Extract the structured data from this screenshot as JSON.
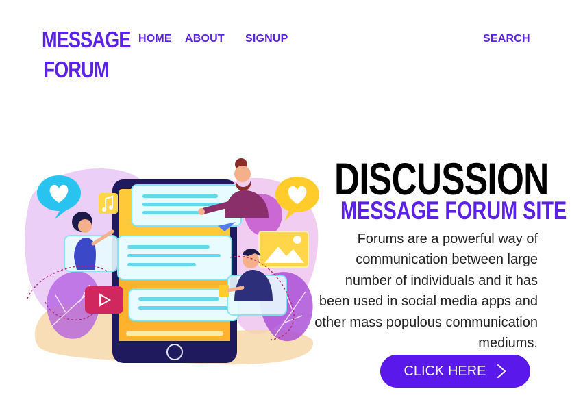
{
  "logo": {
    "line1": "MESSAGE",
    "line2": "FORUM"
  },
  "nav": {
    "home": "HOME",
    "about": "ABOUT",
    "signup": "SIGNUP",
    "search": "SEARCH"
  },
  "hero": {
    "title": "DISCUSSION",
    "subtitle": "MESSAGE FORUM SITE",
    "description": "Forums are a powerful way of communication between large number of individuals and it has been used in social media apps and other mass populous communication mediums.",
    "cta_label": "CLICK HERE",
    "cta_icon": "chevron-right-icon"
  },
  "colors": {
    "accent": "#5b21e6",
    "button": "#5b18ea",
    "title": "#000000",
    "text": "#222222"
  },
  "illustration": {
    "name": "chat-forum-illustration"
  }
}
